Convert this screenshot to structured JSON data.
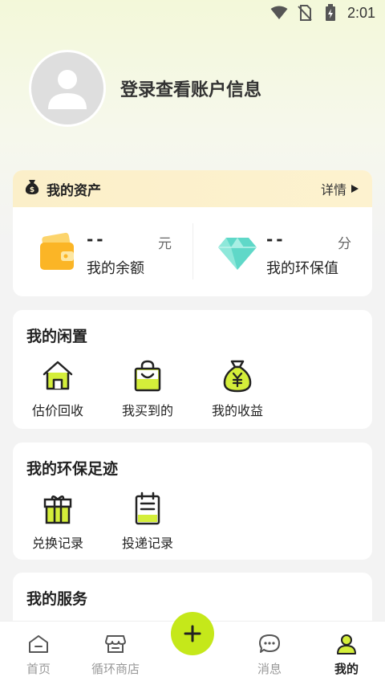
{
  "status_bar": {
    "time": "2:01"
  },
  "profile": {
    "login_prompt": "登录查看账户信息"
  },
  "assets": {
    "title": "我的资产",
    "detail_label": "详情",
    "balance": {
      "value": "--",
      "unit": "元",
      "label": "我的余额"
    },
    "eco_value": {
      "value": "--",
      "unit": "分",
      "label": "我的环保值"
    }
  },
  "idle": {
    "title": "我的闲置",
    "items": [
      {
        "label": "估价回收",
        "icon": "house-icon"
      },
      {
        "label": "我买到的",
        "icon": "shopping-bag-icon"
      },
      {
        "label": "我的收益",
        "icon": "money-bag-icon"
      }
    ]
  },
  "footprint": {
    "title": "我的环保足迹",
    "items": [
      {
        "label": "兑换记录",
        "icon": "gift-icon"
      },
      {
        "label": "投递记录",
        "icon": "clipboard-icon"
      }
    ]
  },
  "services": {
    "title": "我的服务"
  },
  "bottom_nav": {
    "items": [
      {
        "label": "首页",
        "icon": "home-icon"
      },
      {
        "label": "循环商店",
        "icon": "store-icon"
      },
      {
        "label": "消息",
        "icon": "message-icon"
      },
      {
        "label": "我的",
        "icon": "user-icon"
      }
    ],
    "active_index": 3
  },
  "colors": {
    "accent": "#c5e81a",
    "assets_header": "#fbefc9"
  }
}
